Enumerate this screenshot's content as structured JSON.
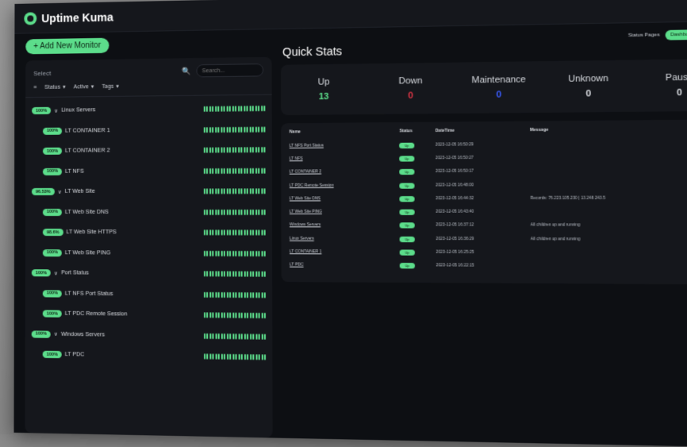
{
  "app": {
    "title": "Uptime Kuma"
  },
  "toolbar": {
    "add_label": "+ Add New Monitor",
    "status_pages": "Status Pages",
    "dashboard": "Dashboard"
  },
  "list_header": {
    "select_label": "Select",
    "search_placeholder": "Search...",
    "filters": {
      "status": "Status",
      "active": "Active",
      "tags": "Tags"
    }
  },
  "monitors": [
    {
      "name": "Linux Servers",
      "uptime": "100%",
      "group": true
    },
    {
      "name": "LT CONTAINER 1",
      "uptime": "100%",
      "group": false
    },
    {
      "name": "LT CONTAINER 2",
      "uptime": "100%",
      "group": false
    },
    {
      "name": "LT NFS",
      "uptime": "100%",
      "group": false
    },
    {
      "name": "LT Web Site",
      "uptime": "96.53%",
      "group": true
    },
    {
      "name": "LT Web Site DNS",
      "uptime": "100%",
      "group": false
    },
    {
      "name": "LT Web Site HTTPS",
      "uptime": "98.6%",
      "group": false
    },
    {
      "name": "LT Web Site PING",
      "uptime": "100%",
      "group": false
    },
    {
      "name": "Port Status",
      "uptime": "100%",
      "group": true
    },
    {
      "name": "LT NFS Port Status",
      "uptime": "100%",
      "group": false
    },
    {
      "name": "LT PDC Remote Session",
      "uptime": "100%",
      "group": false
    },
    {
      "name": "Windows Servers",
      "uptime": "100%",
      "group": true
    },
    {
      "name": "LT PDC",
      "uptime": "100%",
      "group": false
    }
  ],
  "quick_stats": {
    "title": "Quick Stats",
    "items": [
      {
        "label": "Up",
        "value": "13",
        "color": "#5cdd8b"
      },
      {
        "label": "Down",
        "value": "0",
        "color": "#dc3545"
      },
      {
        "label": "Maintenance",
        "value": "0",
        "color": "#3a5cff"
      },
      {
        "label": "Unknown",
        "value": "0",
        "color": "#d6d9de"
      },
      {
        "label": "Pause",
        "value": "0",
        "color": "#d6d9de"
      }
    ]
  },
  "events_table": {
    "headers": [
      "Name",
      "Status",
      "DateTime",
      "Message"
    ],
    "rows": [
      {
        "name": "LT NFS Port Status",
        "status": "Up",
        "datetime": "2023-12-05 16:50:29",
        "message": ""
      },
      {
        "name": "LT NFS",
        "status": "Up",
        "datetime": "2023-12-05 16:50:27",
        "message": ""
      },
      {
        "name": "LT CONTAINER 2",
        "status": "Up",
        "datetime": "2023-12-05 16:50:17",
        "message": ""
      },
      {
        "name": "LT PDC Remote Session",
        "status": "Up",
        "datetime": "2023-12-05 16:48:00",
        "message": ""
      },
      {
        "name": "LT Web Site DNS",
        "status": "Up",
        "datetime": "2023-12-05 16:44:32",
        "message": "Records: 76.223.105.230 | 13.248.243.5"
      },
      {
        "name": "LT Web Site PING",
        "status": "Up",
        "datetime": "2023-12-05 16:43:40",
        "message": ""
      },
      {
        "name": "Windows Servers",
        "status": "Up",
        "datetime": "2023-12-05 16:37:12",
        "message": "All children up and running"
      },
      {
        "name": "Linux Servers",
        "status": "Up",
        "datetime": "2023-12-05 16:36:29",
        "message": "All children up and running"
      },
      {
        "name": "LT CONTAINER 1",
        "status": "Up",
        "datetime": "2023-12-05 16:25:25",
        "message": ""
      },
      {
        "name": "LT PDC",
        "status": "Up",
        "datetime": "2023-12-05 16:22:15",
        "message": ""
      }
    ]
  },
  "colors": {
    "accent": "#5cdd8b",
    "background": "#0d0f13",
    "card": "#15171c"
  }
}
